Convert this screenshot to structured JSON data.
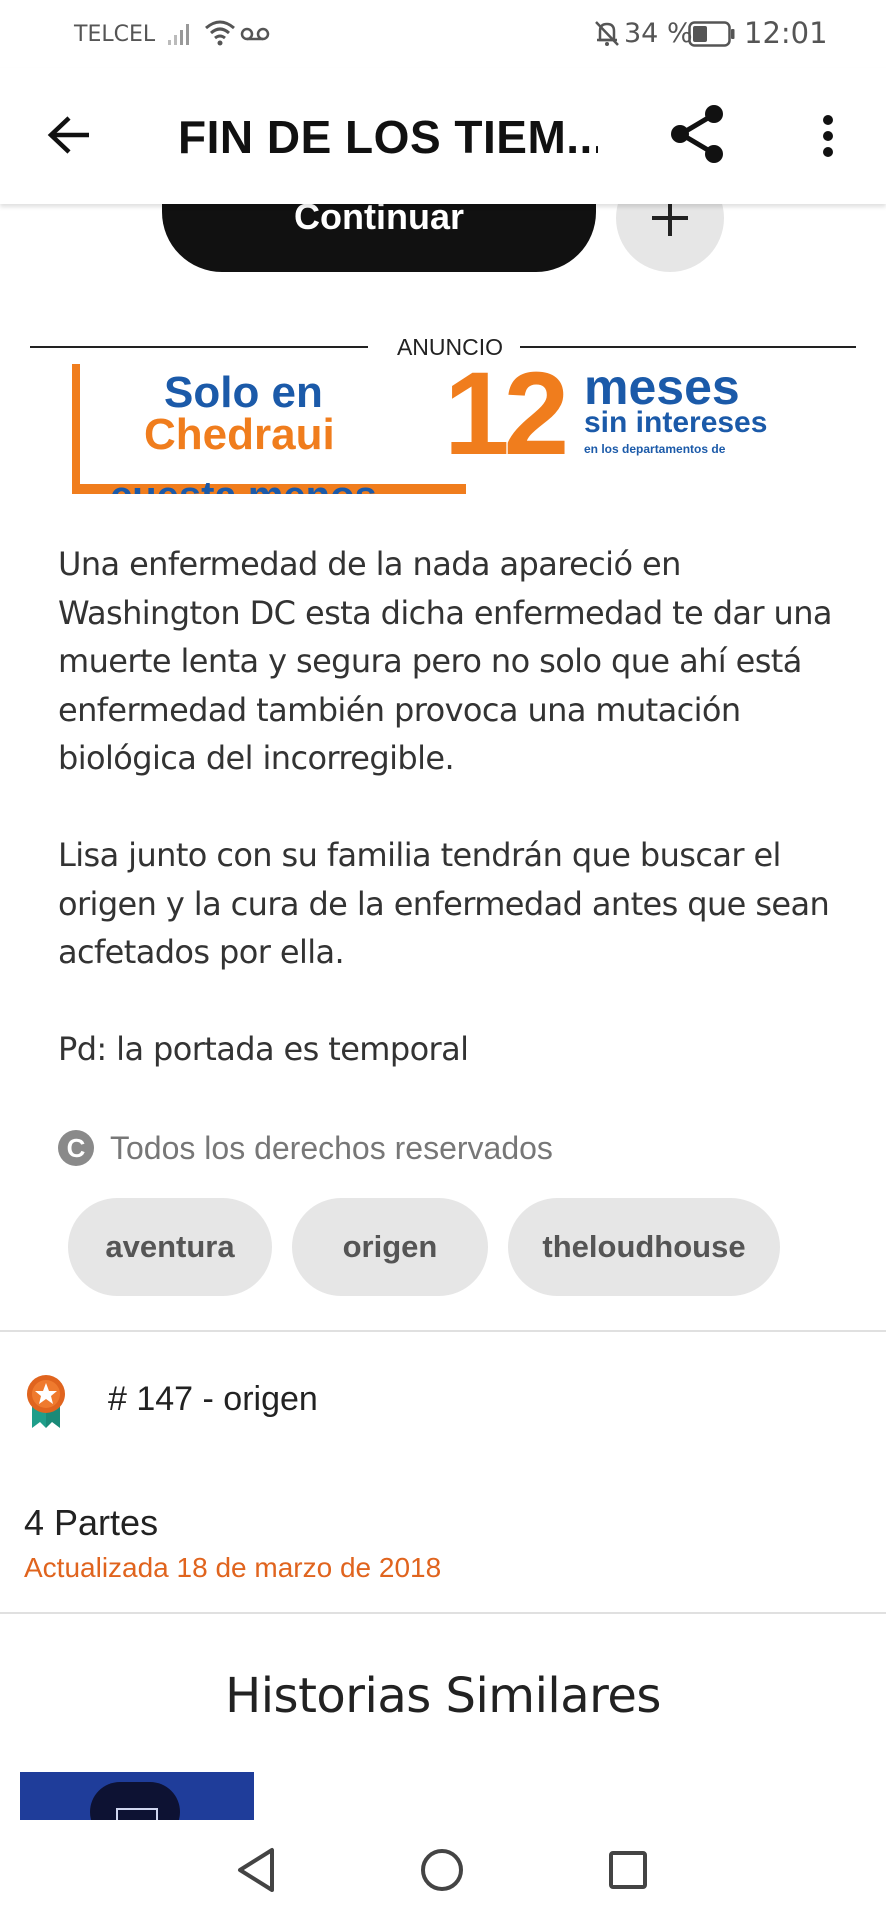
{
  "status_bar": {
    "carrier": "TELCEL",
    "battery_percent": "34 %",
    "time": "12:01"
  },
  "app_bar": {
    "title": "FIN DE LOS TIEM...",
    "icons": [
      "back-arrow-icon",
      "share-icon",
      "more-vertical-icon"
    ]
  },
  "actions": {
    "continue_label": "Continuar",
    "add_label": "+"
  },
  "ad": {
    "label": "ANUNCIO",
    "line1": "Solo en",
    "line2": "Chedraui",
    "big_number": "12",
    "meses": "meses",
    "sin_intereses": "sin intereses",
    "fine_print": "en los departamentos de",
    "cut_text": "cuesta menos",
    "colors": {
      "orange": "#f07d1d",
      "blue": "#1b5aa9"
    }
  },
  "description": {
    "paragraphs": [
      "Una enfermedad de la nada apareció en Washington DC esta dicha enfermedad te dar una muerte lenta y segura pero no solo que ahí está enfermedad también provoca una mutación biológica del incorregible.",
      "Lisa junto con su familia tendrán que buscar el origen y la cura de la enfermedad antes que sean acfetados por ella.",
      "Pd: la portada es temporal"
    ]
  },
  "rights": {
    "icon_letter": "C",
    "text": "Todos los derechos reservados"
  },
  "tags": [
    "aventura",
    "origen",
    "theloudhouse"
  ],
  "ranking": {
    "text": "# 147 - origen"
  },
  "story_info": {
    "parts": "4 Partes",
    "updated": "Actualizada 18 de marzo de 2018",
    "updated_color": "#e0641e"
  },
  "similar": {
    "title": "Historias Similares"
  },
  "nav_bar": {
    "icons": [
      "nav-back-icon",
      "nav-home-icon",
      "nav-recents-icon"
    ]
  }
}
